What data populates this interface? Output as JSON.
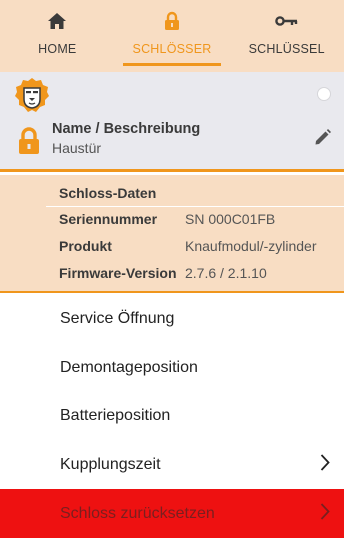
{
  "tabs": [
    {
      "label": "HOME",
      "icon": "home-icon",
      "active": false
    },
    {
      "label": "SCHLÖSSER",
      "icon": "lock-icon",
      "active": true
    },
    {
      "label": "SCHLÜSSEL",
      "icon": "key-icon",
      "active": false
    }
  ],
  "lock": {
    "name_label": "Name / Beschreibung",
    "name_value": "Haustür"
  },
  "details": {
    "header": "Schloss-Daten",
    "rows": [
      {
        "key": "Seriennummer",
        "value": "SN 000C01FB"
      },
      {
        "key": "Produkt",
        "value": "Knaufmodul/-zylinder"
      },
      {
        "key": "Firmware-Version",
        "value": "2.7.6 / 2.1.10"
      }
    ]
  },
  "menu": [
    {
      "label": "Service Öffnung",
      "chevron": false
    },
    {
      "label": "Demontageposition",
      "chevron": false
    },
    {
      "label": "Batterieposition",
      "chevron": false
    },
    {
      "label": "Kupplungszeit",
      "chevron": true
    },
    {
      "label": "Schloss zurücksetzen",
      "chevron": true,
      "danger": true
    }
  ],
  "colors": {
    "accent": "#f0961c",
    "tab_background": "#f8ddc3",
    "card_background": "#e9e9ee",
    "danger": "#ee1111"
  }
}
